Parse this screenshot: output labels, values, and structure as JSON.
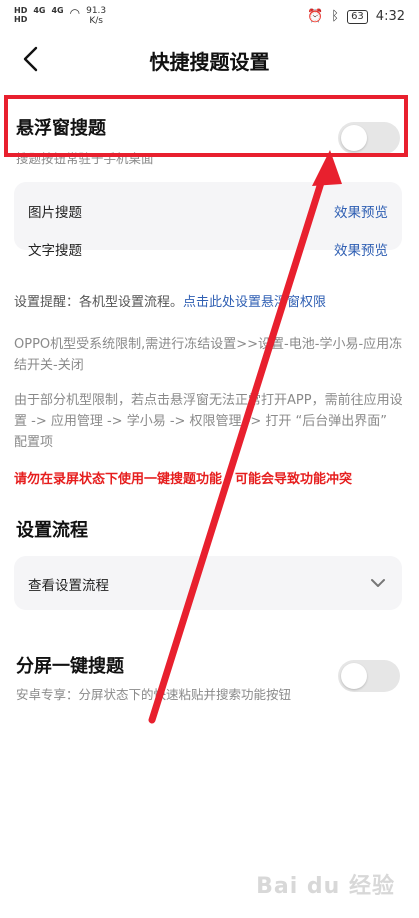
{
  "status_bar": {
    "sim1": "HD",
    "sim2": "HD",
    "signal": "4G",
    "speed_value": "91.3",
    "speed_unit": "K/s",
    "battery": "63",
    "time": "4:32"
  },
  "header": {
    "title": "快捷搜题设置"
  },
  "floating": {
    "title": "悬浮窗搜题",
    "subtitle": "搜题按钮常驻于手机桌面",
    "toggle_on": false
  },
  "search_modes": [
    {
      "label": "图片搜题",
      "action": "效果预览"
    },
    {
      "label": "文字搜题",
      "action": "效果预览"
    }
  ],
  "notes": {
    "reminder_prefix": "设置提醒：各机型设置流程。",
    "reminder_link": "点击此处设置悬浮窗权限",
    "oppo_note": "OPPO机型受系统限制,需进行冻结设置>>设置-电池-学小易-应用冻结开关-关闭",
    "other_note": "由于部分机型限制，若点击悬浮窗无法正常打开APP，需前往应用设置 -> 应用管理 -> 学小易 -> 权限管理 -> 打开 “后台弹出界面” 配置项",
    "warning": "请勿在录屏状态下使用一键搜题功能，可能会导致功能冲突"
  },
  "process": {
    "title": "设置流程",
    "view_label": "查看设置流程"
  },
  "split": {
    "title": "分屏一键搜题",
    "subtitle": "安卓专享：分屏状态下的快速粘贴并搜索功能按钮",
    "toggle_on": false
  },
  "watermark": "Bai du 经验",
  "annotation_color": "#e8202e"
}
